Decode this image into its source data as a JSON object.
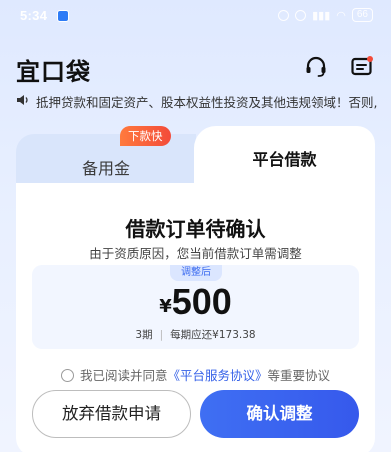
{
  "status_bar": {
    "time": "5:34",
    "battery": "66"
  },
  "header": {
    "logo": "宜口袋",
    "support_icon": "headset-icon",
    "message_icon": "message-icon"
  },
  "marquee": {
    "icon": "speaker-icon",
    "text": "抵押贷款和固定资产、股本权益性投资及其他违规领域！否则,"
  },
  "tabs": [
    {
      "label": "备用金",
      "badge": "下款快"
    },
    {
      "label": "平台借款",
      "active": true
    }
  ],
  "order": {
    "title": "借款订单待确认",
    "subtitle": "由于资质原因，您当前借款订单需调整",
    "adjusted_tag": "调整后",
    "currency": "¥",
    "amount": "500",
    "periods": "3期",
    "per_period": "每期应还¥173.38"
  },
  "agreement": {
    "prefix": "我已阅读并同意",
    "link": "《平台服务协议》",
    "suffix": "等重要协议"
  },
  "buttons": {
    "cancel": "放弃借款申请",
    "confirm": "确认调整"
  },
  "colors": {
    "accent": "#3659ec",
    "badge": "#f34b3a"
  }
}
